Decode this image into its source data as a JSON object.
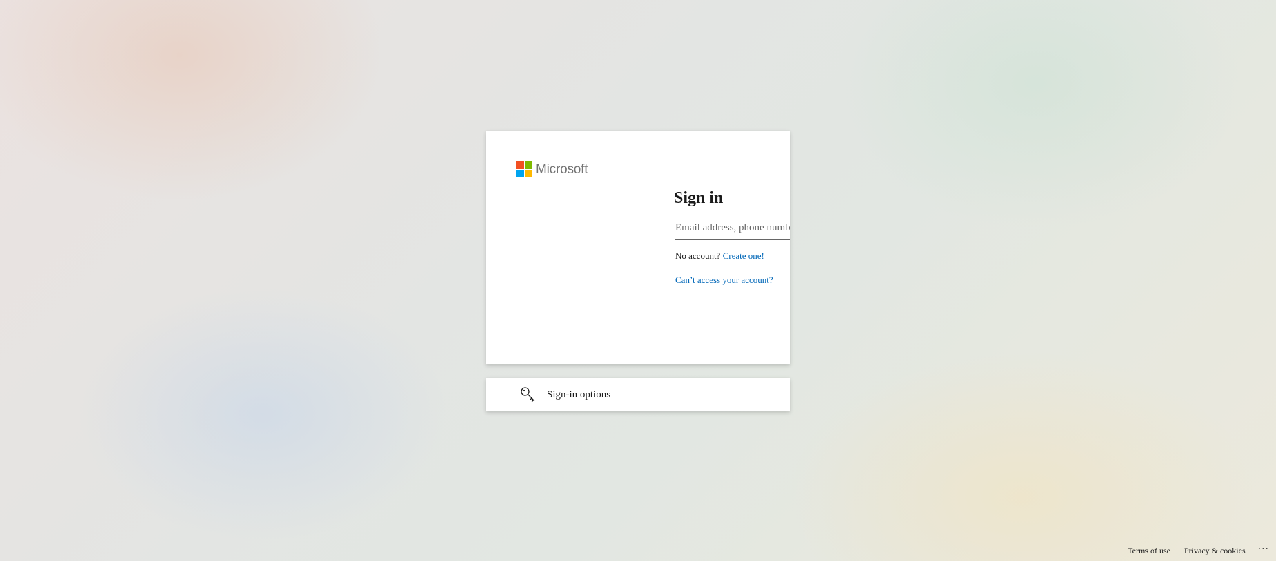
{
  "brand": {
    "name": "Microsoft",
    "logo_colors": [
      "#f25022",
      "#7fba00",
      "#00a4ef",
      "#ffb900"
    ]
  },
  "signin": {
    "title": "Sign in",
    "email_placeholder": "Email address, phone number or Skype",
    "email_value": "",
    "no_account_text": "No account?",
    "create_link": "Create one!",
    "cant_access_link": "Can’t access your account?"
  },
  "options": {
    "label": "Sign-in options",
    "icon": "key-icon"
  },
  "footer": {
    "terms": "Terms of use",
    "privacy": "Privacy & cookies",
    "more": "···"
  },
  "colors": {
    "link": "#0067b8",
    "text": "#1b1b1b"
  }
}
